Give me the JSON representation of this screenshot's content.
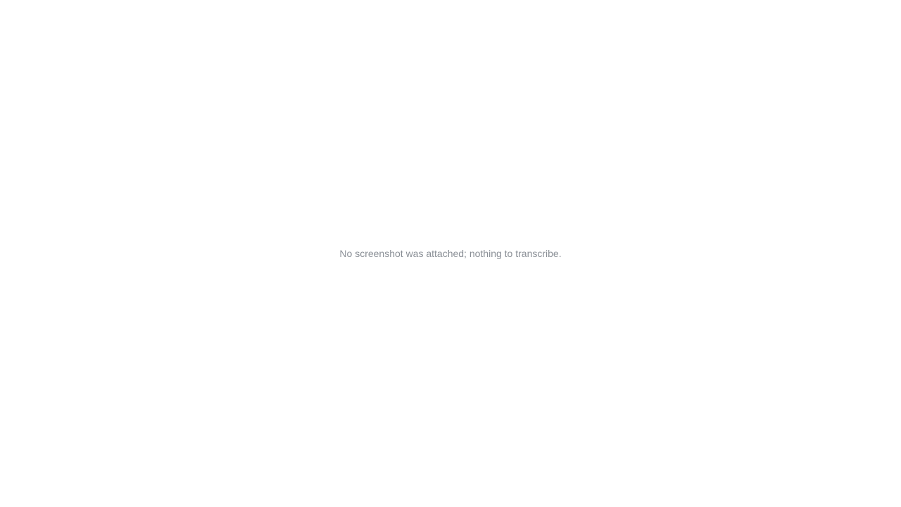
{
  "notice": "No screenshot was attached; nothing to transcribe."
}
